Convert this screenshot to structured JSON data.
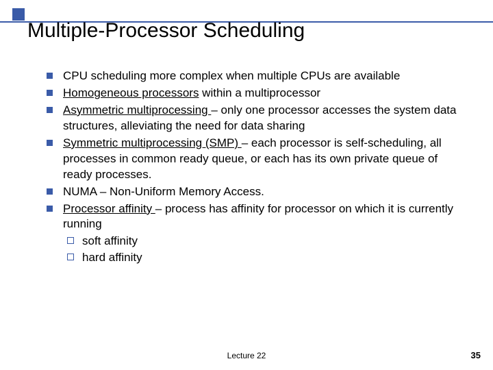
{
  "title": "Multiple-Processor Scheduling",
  "bullets": {
    "b0": "CPU scheduling more complex when multiple CPUs are available",
    "b1_u": "Homogeneous processors",
    "b1_rest": " within a multiprocessor",
    "b2_u": "Asymmetric multiprocessing ",
    "b2_rest": "– only one processor accesses the system data structures, alleviating the need for data sharing",
    "b3_u": "Symmetric multiprocessing  (SMP) ",
    "b3_rest": "– each processor is self-scheduling, all processes in common ready queue, or each has its own private queue of ready processes.",
    "b4": "NUMA – Non-Uniform Memory Access.",
    "b5_u": "Processor affinity ",
    "b5_rest": "– process has affinity for processor on which it is currently running",
    "b5_sub0": "soft affinity",
    "b5_sub1": "hard affinity"
  },
  "footer": {
    "center": "Lecture 22",
    "right": "35"
  }
}
